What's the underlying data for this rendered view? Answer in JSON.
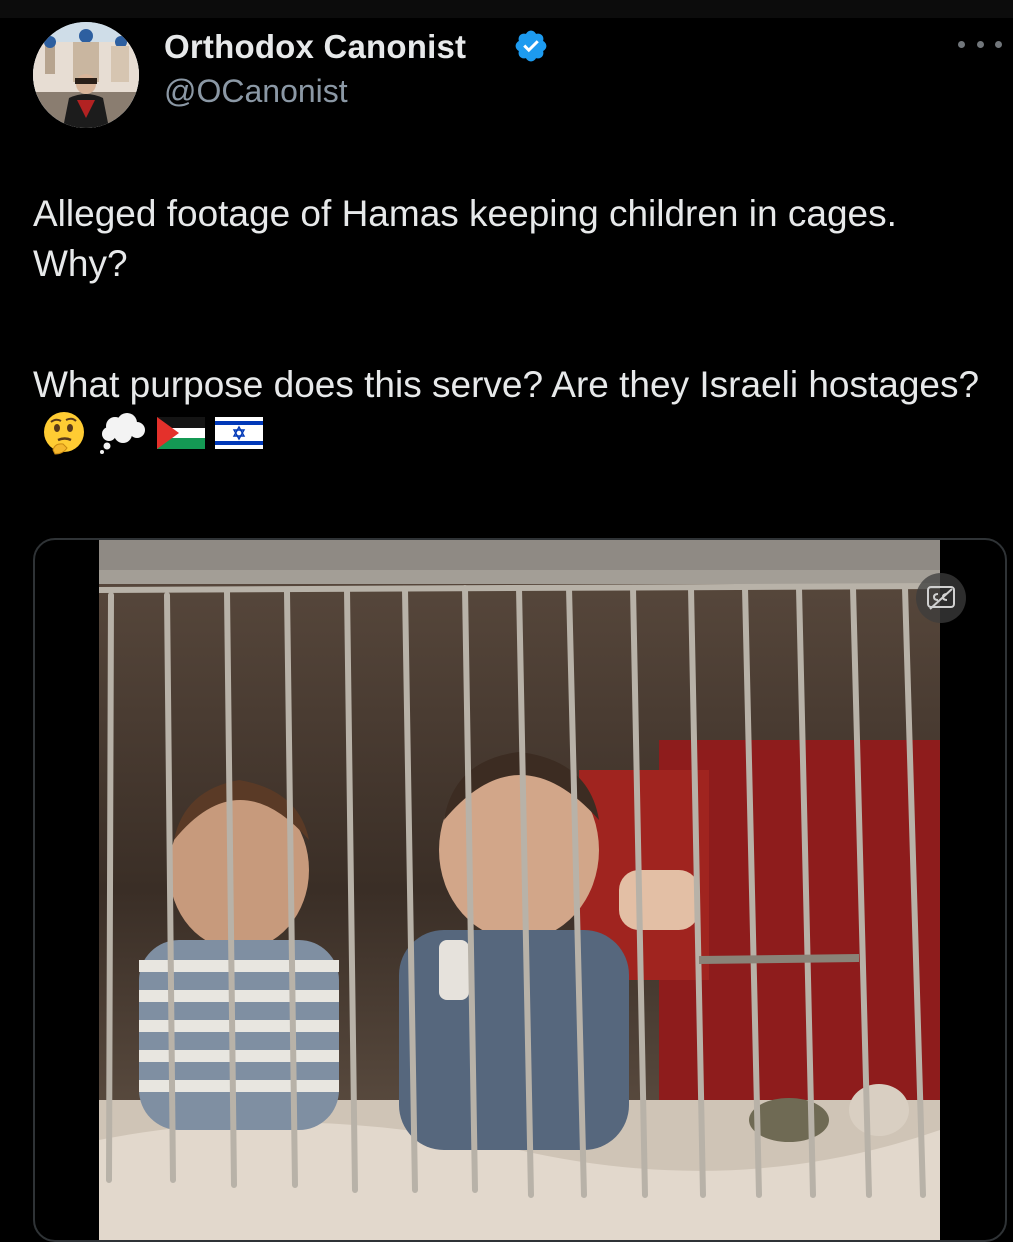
{
  "tweet": {
    "display_name": "Orthodox Canonist",
    "handle": "@OCanonist",
    "verified": true,
    "text_line1": "Alleged footage of Hamas keeping children in cages. Why?",
    "text_line2": "What purpose does this serve? Are they Israeli hostages?",
    "emojis": [
      "thinking-face",
      "thought-balloon",
      "palestine-flag",
      "israel-flag"
    ]
  },
  "media": {
    "type": "video",
    "captions_control": "CC"
  },
  "colors": {
    "background": "#000000",
    "text": "#e7e9ea",
    "secondary_text": "#8b98a5",
    "verified_blue": "#1d9bf0",
    "border": "#2f3336"
  }
}
